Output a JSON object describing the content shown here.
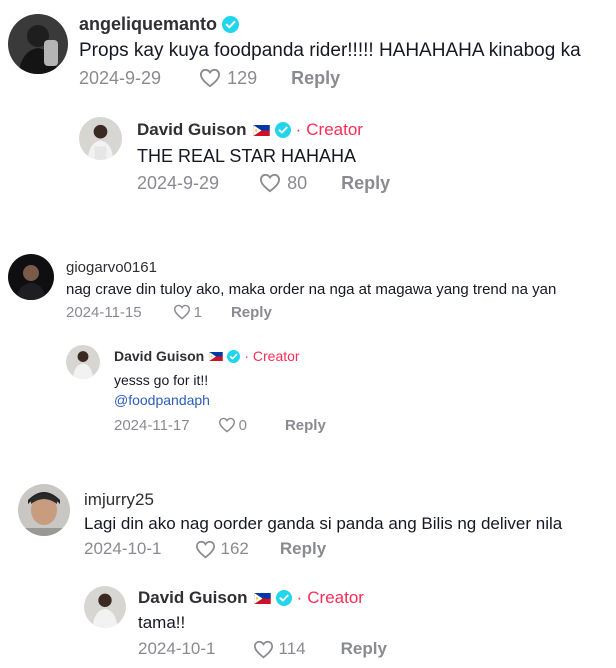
{
  "comments": [
    {
      "username": "angeliquemanto",
      "text": "Props kay kuya foodpanda rider!!!!! HAHAHAHA kinabog ka",
      "date": "2024-9-29",
      "likes": "129",
      "reply_label": "Reply",
      "reply": {
        "username": "David Guison",
        "creator_label": "Creator",
        "separator": "·",
        "text": "THE REAL STAR HAHAHA",
        "date": "2024-9-29",
        "likes": "80",
        "reply_label": "Reply"
      }
    },
    {
      "username": "giogarvo0161",
      "text": "nag crave din tuloy ako, maka order na nga at magawa yang trend na yan",
      "date": "2024-11-15",
      "likes": "1",
      "reply_label": "Reply",
      "reply": {
        "username": "David Guison",
        "creator_label": "Creator",
        "separator": "·",
        "text": "yesss go for it!!",
        "mention": "@foodpandaph",
        "date": "2024-11-17",
        "likes": "0",
        "reply_label": "Reply"
      }
    },
    {
      "username": "imjurry25",
      "text": "Lagi din ako nag oorder ganda si panda ang Bilis ng deliver nila",
      "date": "2024-10-1",
      "likes": "162",
      "reply_label": "Reply",
      "reply": {
        "username": "David Guison",
        "creator_label": "Creator",
        "separator": "·",
        "text": "tama!!",
        "date": "2024-10-1",
        "likes": "114",
        "reply_label": "Reply"
      }
    }
  ],
  "colors": {
    "verified": "#20d5ec",
    "creator": "#fe2c55",
    "mention": "#2b5db9",
    "meta": "#8a8b91"
  }
}
